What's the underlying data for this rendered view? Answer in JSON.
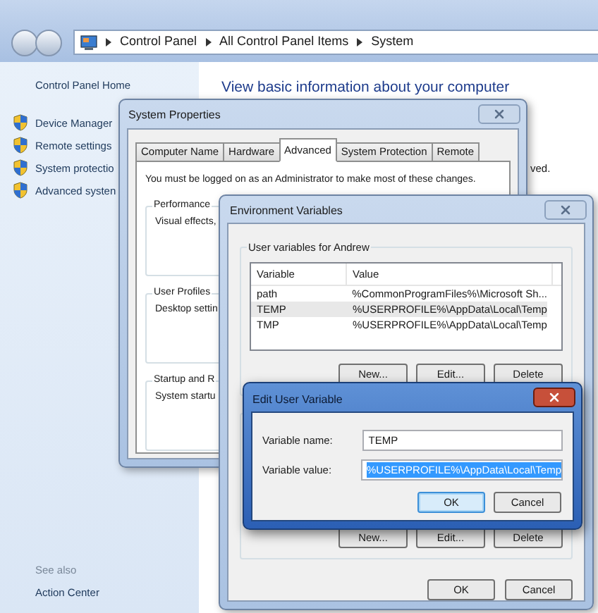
{
  "explorer": {
    "address": [
      "Control Panel",
      "All Control Panel Items",
      "System"
    ],
    "sidebar": {
      "home": "Control Panel Home",
      "tasks": [
        "Device Manager",
        "Remote settings",
        "System protectio",
        "Advanced systen"
      ],
      "see_also_heading": "See also",
      "see_also": [
        "Action Center"
      ]
    },
    "heading": "View basic information about your computer",
    "partial_text": "ved."
  },
  "system_properties": {
    "title": "System Properties",
    "tabs": [
      {
        "label": "Computer Name",
        "selected": false
      },
      {
        "label": "Hardware",
        "selected": false
      },
      {
        "label": "Advanced",
        "selected": true
      },
      {
        "label": "System Protection",
        "selected": false
      },
      {
        "label": "Remote",
        "selected": false
      }
    ],
    "notice": "You must be logged on as an Administrator to make most of these changes.",
    "groups": [
      {
        "title": "Performance",
        "text": "Visual effects,"
      },
      {
        "title": "User Profiles",
        "text": "Desktop settin"
      },
      {
        "title": "Startup and R",
        "text": "System startu"
      }
    ]
  },
  "environment_variables": {
    "title": "Environment Variables",
    "group_label": "User variables for Andrew",
    "columns": [
      "Variable",
      "Value"
    ],
    "rows": [
      {
        "variable": "path",
        "value": "%CommonProgramFiles%\\Microsoft Sh...",
        "selected": false
      },
      {
        "variable": "TEMP",
        "value": "%USERPROFILE%\\AppData\\Local\\Temp",
        "selected": true
      },
      {
        "variable": "TMP",
        "value": "%USERPROFILE%\\AppData\\Local\\Temp",
        "selected": false
      }
    ],
    "user_buttons": [
      "New...",
      "Edit...",
      "Delete"
    ],
    "system_buttons": [
      "New...",
      "Edit...",
      "Delete"
    ],
    "buttons": [
      "OK",
      "Cancel"
    ]
  },
  "edit_user_variable": {
    "title": "Edit User Variable",
    "fields": [
      {
        "label": "Variable name:",
        "value": "TEMP",
        "highlighted": false
      },
      {
        "label": "Variable value:",
        "value": "%USERPROFILE%\\AppData\\Local\\Temp",
        "highlighted": true
      }
    ],
    "buttons": [
      {
        "label": "OK",
        "default": true
      },
      {
        "label": "Cancel",
        "default": false
      }
    ]
  }
}
